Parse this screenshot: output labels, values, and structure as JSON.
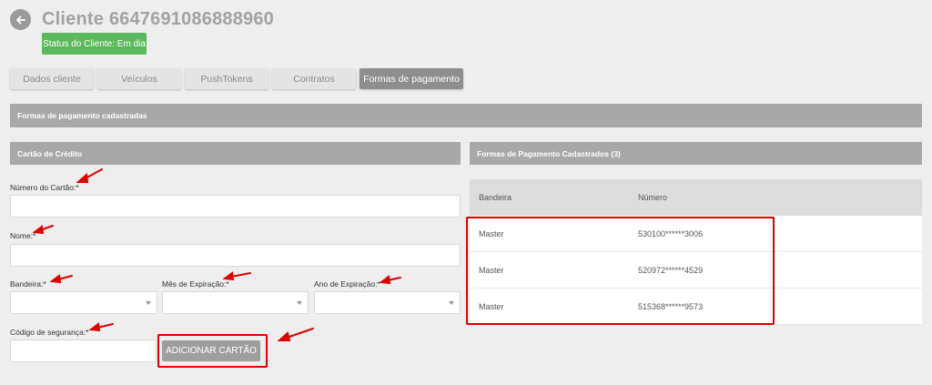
{
  "header": {
    "title": "Cliente 6647691086888960",
    "status": "Status do Cliente: Em dia"
  },
  "tabs": [
    "Dados cliente",
    "Veículos",
    "PushTokens",
    "Contratos",
    "Formas de pagamento"
  ],
  "active_tab": "Formas de pagamento",
  "section_main": "Formas de pagamento cadastradas",
  "card_form": {
    "title": "Cartão de Crédito",
    "card_number_label": "Número do Cartão:*",
    "name_label": "Nome:*",
    "brand_label": "Bandeira:*",
    "exp_month_label": "Mês de Expiração:*",
    "exp_year_label": "Ano de Expiração:*",
    "security_code_label": "Código de segurança:*",
    "add_button": "ADICIONAR CARTÃO"
  },
  "saved_methods": {
    "title": "Formas de Pagamento Cadastrados (3)",
    "columns": [
      "Bandeira",
      "Número"
    ],
    "rows": [
      {
        "brand": "Master",
        "number": "530100******3006"
      },
      {
        "brand": "Master",
        "number": "520972******4529"
      },
      {
        "brand": "Master",
        "number": "515368******9573"
      }
    ]
  },
  "colors": {
    "status_green": "#5cb85c",
    "annotation_red": "#e10000",
    "bar_grey": "#a8a8a8"
  },
  "icons": [
    "arrow-left-icon",
    "chevron-down-icon"
  ]
}
